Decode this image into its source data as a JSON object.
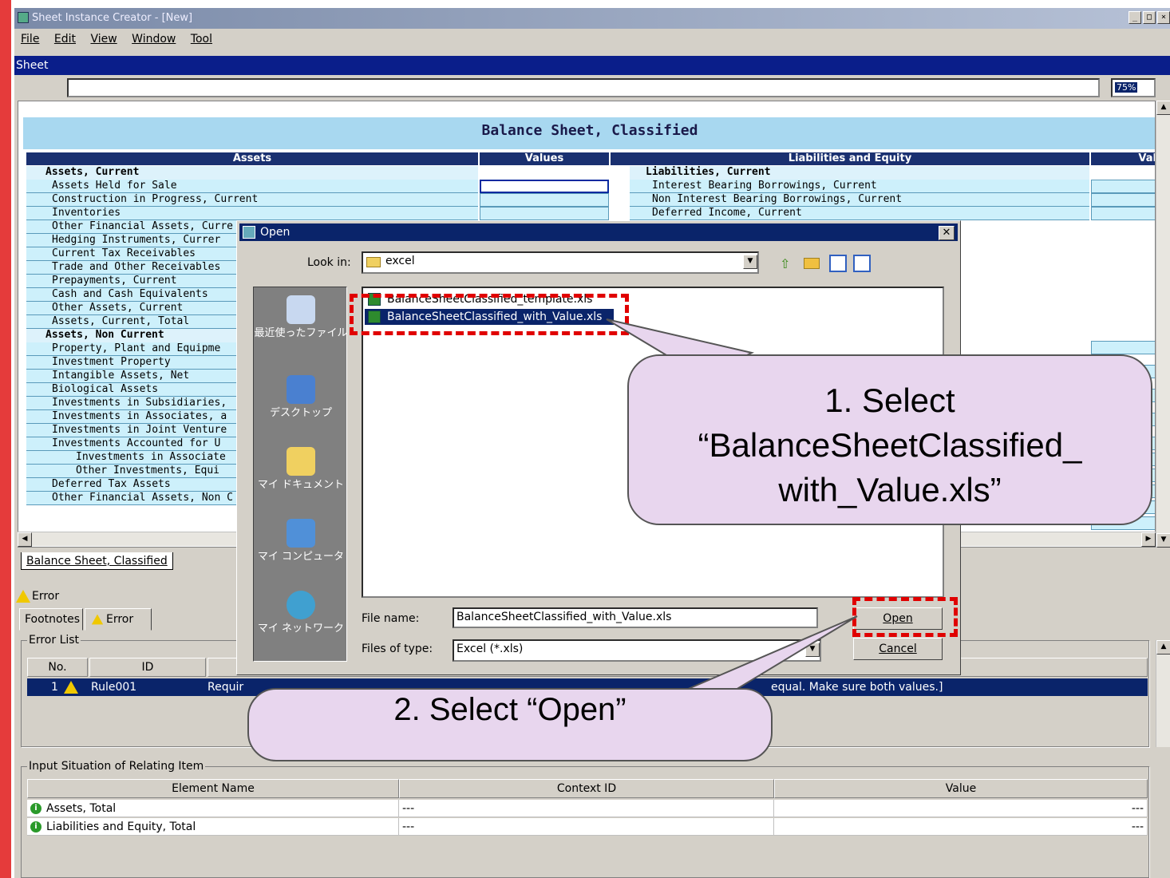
{
  "app": {
    "title": "Sheet Instance Creator - [New]",
    "caption_buttons": [
      "_",
      "□",
      "×"
    ]
  },
  "menu": [
    "File",
    "Edit",
    "View",
    "Window",
    "Tool"
  ],
  "sheet_panel": {
    "title": "Sheet",
    "zoom": "75%",
    "heading": "Balance Sheet, Classified",
    "columns": {
      "assets": "Assets",
      "values": "Values",
      "liabilities": "Liabilities and Equity",
      "values_right": "Val"
    },
    "left_rows": [
      {
        "label": "Assets, Current",
        "kind": "hdr"
      },
      {
        "label": "Assets Held for Sale",
        "kind": "item"
      },
      {
        "label": "Construction in Progress, Current",
        "kind": "item"
      },
      {
        "label": "Inventories",
        "kind": "item"
      },
      {
        "label": "Other Financial Assets, Curre",
        "kind": "item"
      },
      {
        "label": "Hedging Instruments, Currer",
        "kind": "item"
      },
      {
        "label": "Current Tax Receivables",
        "kind": "item"
      },
      {
        "label": "Trade and Other Receivables",
        "kind": "item"
      },
      {
        "label": "Prepayments, Current",
        "kind": "item"
      },
      {
        "label": "Cash and Cash Equivalents",
        "kind": "item"
      },
      {
        "label": "Other Assets, Current",
        "kind": "item"
      },
      {
        "label": "Assets, Current, Total",
        "kind": "item"
      },
      {
        "label": "Assets, Non Current",
        "kind": "hdr"
      },
      {
        "label": "Property, Plant and Equipme",
        "kind": "item"
      },
      {
        "label": "Investment Property",
        "kind": "item"
      },
      {
        "label": "Intangible Assets, Net",
        "kind": "item"
      },
      {
        "label": "Biological Assets",
        "kind": "item"
      },
      {
        "label": "Investments in Subsidiaries,",
        "kind": "item"
      },
      {
        "label": "Investments in Associates, a",
        "kind": "item"
      },
      {
        "label": "Investments in Joint Venture",
        "kind": "item"
      },
      {
        "label": "Investments Accounted for U",
        "kind": "item"
      },
      {
        "label": "Investments in Associate",
        "kind": "sub"
      },
      {
        "label": "Other Investments, Equi",
        "kind": "sub"
      },
      {
        "label": "Deferred Tax Assets",
        "kind": "item"
      },
      {
        "label": "Other Financial Assets, Non C",
        "kind": "item"
      }
    ],
    "right_rows": [
      {
        "label": "Liabilities, Current",
        "kind": "hdr"
      },
      {
        "label": "Interest Bearing Borrowings, Current",
        "kind": "item"
      },
      {
        "label": "Non Interest Bearing Borrowings, Current",
        "kind": "item"
      },
      {
        "label": "Deferred Income, Current",
        "kind": "item"
      }
    ],
    "tab": "Balance Sheet, Classified"
  },
  "error_panel": {
    "title": "Error",
    "tabs": [
      "Footnotes",
      "Error"
    ],
    "error_list_label": "Error List",
    "columns": [
      "No.",
      "ID"
    ],
    "row": {
      "no": "1",
      "id": "Rule001",
      "msg_start": "Requir",
      "msg_end": "equal. Make sure both values.]"
    },
    "input_label": "Input Situation of Relating Item",
    "input_columns": [
      "Element Name",
      "Context ID",
      "Value"
    ],
    "input_rows": [
      {
        "name": "Assets, Total",
        "context": "---",
        "value": "---"
      },
      {
        "name": "Liabilities and Equity, Total",
        "context": "---",
        "value": "---"
      }
    ]
  },
  "open_dialog": {
    "title": "Open",
    "look_in_label": "Look in:",
    "look_in_value": "excel",
    "places": [
      "最近使ったファイル",
      "デスクトップ",
      "マイ ドキュメント",
      "マイ コンピュータ",
      "マイ ネットワーク"
    ],
    "files": [
      "BalanceSheetClassified_template.xls",
      "BalanceSheetClassified_with_Value.xls"
    ],
    "file_name_label": "File name:",
    "file_name_value": "BalanceSheetClassified_with_Value.xls",
    "file_type_label": "Files of type:",
    "file_type_value": "Excel (*.xls)",
    "open_label": "Open",
    "cancel_label": "Cancel"
  },
  "annotations": {
    "callout1_line1": "1. Select",
    "callout1_line2": "“BalanceSheetClassified_",
    "callout1_line3": "with_Value.xls”",
    "callout2": "2. Select “Open”",
    "highlight_color": "#e00000",
    "callout_fill": "#e8d6ee"
  }
}
